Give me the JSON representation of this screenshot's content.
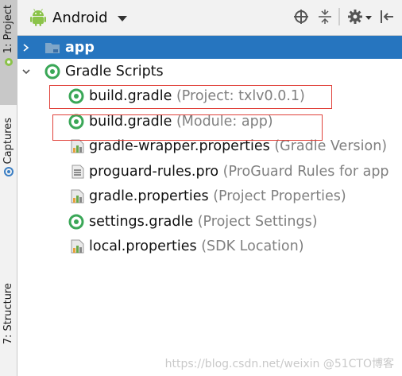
{
  "side_tabs": {
    "project": "1: Project",
    "captures": "Captures",
    "structure": "7: Structure"
  },
  "header": {
    "view_mode": "Android",
    "tools": [
      "target-icon",
      "collapse-icon",
      "gear-icon",
      "hide-icon"
    ]
  },
  "tree": {
    "app": {
      "label": "app"
    },
    "gradle_scripts": {
      "label": "Gradle Scripts"
    },
    "files": [
      {
        "name": "build.gradle",
        "hint": "(Project: txlv0.0.1)",
        "icon": "gradle-icon"
      },
      {
        "name": "build.gradle",
        "hint": "(Module: app)",
        "icon": "gradle-icon"
      },
      {
        "name": "gradle-wrapper.properties",
        "hint": "(Gradle Version)",
        "icon": "properties-icon"
      },
      {
        "name": "proguard-rules.pro",
        "hint": "(ProGuard Rules for app",
        "icon": "text-file-icon"
      },
      {
        "name": "gradle.properties",
        "hint": "(Project Properties)",
        "icon": "properties-icon"
      },
      {
        "name": "settings.gradle",
        "hint": "(Project Settings)",
        "icon": "gradle-icon"
      },
      {
        "name": "local.properties",
        "hint": "(SDK Location)",
        "icon": "properties-icon"
      }
    ]
  },
  "watermark": "https://blog.csdn.net/weixin  @51CTO博客",
  "colors": {
    "selection": "#2675bf",
    "highlight_box": "#e0413a",
    "gradle_green": "#3aa757",
    "android_green": "#8bc34a"
  }
}
